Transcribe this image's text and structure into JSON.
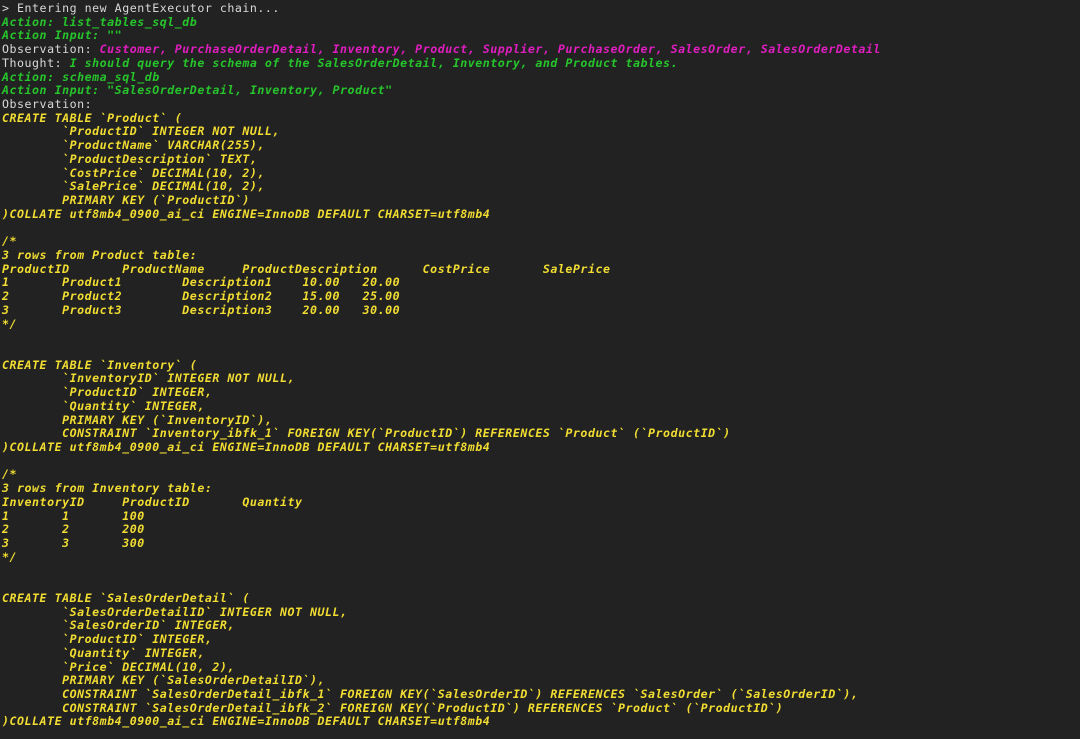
{
  "terminal": {
    "title": "AgentExecutor chain output",
    "colors": {
      "background": "#222222",
      "plain": "#d8d8d8",
      "green": "#27c52c",
      "magenta": "#e01ec0",
      "yellow": "#f2dd32"
    },
    "lines": [
      {
        "id": "l0",
        "role": "plain",
        "text": "> Entering new AgentExecutor chain..."
      },
      {
        "id": "l1",
        "role": "green",
        "text": "Action: list_tables_sql_db"
      },
      {
        "id": "l2",
        "role": "green",
        "text": "Action Input: \"\""
      },
      {
        "id": "l3",
        "role": "mixed",
        "label": "Observation: ",
        "label_role": "plain",
        "value": "Customer, PurchaseOrderDetail, Inventory, Product, Supplier, PurchaseOrder, SalesOrder, SalesOrderDetail",
        "value_role": "magenta"
      },
      {
        "id": "l4",
        "role": "mixed",
        "label": "Thought: ",
        "label_role": "plain",
        "value": "I should query the schema of the SalesOrderDetail, Inventory, and Product tables.",
        "value_role": "green"
      },
      {
        "id": "l5",
        "role": "green",
        "text": "Action: schema_sql_db"
      },
      {
        "id": "l6",
        "role": "green",
        "text": "Action Input: \"SalesOrderDetail, Inventory, Product\""
      },
      {
        "id": "l7",
        "role": "plain",
        "text": "Observation:"
      },
      {
        "id": "l8",
        "role": "yellow",
        "text": "CREATE TABLE `Product` ("
      },
      {
        "id": "l9",
        "role": "yellow",
        "text": "        `ProductID` INTEGER NOT NULL,"
      },
      {
        "id": "l10",
        "role": "yellow",
        "text": "        `ProductName` VARCHAR(255),"
      },
      {
        "id": "l11",
        "role": "yellow",
        "text": "        `ProductDescription` TEXT,"
      },
      {
        "id": "l12",
        "role": "yellow",
        "text": "        `CostPrice` DECIMAL(10, 2),"
      },
      {
        "id": "l13",
        "role": "yellow",
        "text": "        `SalePrice` DECIMAL(10, 2),"
      },
      {
        "id": "l14",
        "role": "yellow",
        "text": "        PRIMARY KEY (`ProductID`)"
      },
      {
        "id": "l15",
        "role": "yellow",
        "text": ")COLLATE utf8mb4_0900_ai_ci ENGINE=InnoDB DEFAULT CHARSET=utf8mb4"
      },
      {
        "id": "l16",
        "role": "blank",
        "text": ""
      },
      {
        "id": "l17",
        "role": "yellow",
        "text": "/*"
      },
      {
        "id": "l18",
        "role": "yellow",
        "text": "3 rows from Product table:"
      },
      {
        "id": "l19",
        "role": "yellow",
        "text": "ProductID\tProductName\tProductDescription\tCostPrice\tSalePrice"
      },
      {
        "id": "l20",
        "role": "yellow",
        "text": "1\tProduct1\tDescription1\t10.00\t20.00"
      },
      {
        "id": "l21",
        "role": "yellow",
        "text": "2\tProduct2\tDescription2\t15.00\t25.00"
      },
      {
        "id": "l22",
        "role": "yellow",
        "text": "3\tProduct3\tDescription3\t20.00\t30.00"
      },
      {
        "id": "l23",
        "role": "yellow",
        "text": "*/"
      },
      {
        "id": "l24",
        "role": "blank",
        "text": ""
      },
      {
        "id": "l25",
        "role": "blank",
        "text": ""
      },
      {
        "id": "l26",
        "role": "yellow",
        "text": "CREATE TABLE `Inventory` ("
      },
      {
        "id": "l27",
        "role": "yellow",
        "text": "        `InventoryID` INTEGER NOT NULL,"
      },
      {
        "id": "l28",
        "role": "yellow",
        "text": "        `ProductID` INTEGER,"
      },
      {
        "id": "l29",
        "role": "yellow",
        "text": "        `Quantity` INTEGER,"
      },
      {
        "id": "l30",
        "role": "yellow",
        "text": "        PRIMARY KEY (`InventoryID`),"
      },
      {
        "id": "l31",
        "role": "yellow",
        "text": "        CONSTRAINT `Inventory_ibfk_1` FOREIGN KEY(`ProductID`) REFERENCES `Product` (`ProductID`)"
      },
      {
        "id": "l32",
        "role": "yellow",
        "text": ")COLLATE utf8mb4_0900_ai_ci ENGINE=InnoDB DEFAULT CHARSET=utf8mb4"
      },
      {
        "id": "l33",
        "role": "blank",
        "text": ""
      },
      {
        "id": "l34",
        "role": "yellow",
        "text": "/*"
      },
      {
        "id": "l35",
        "role": "yellow",
        "text": "3 rows from Inventory table:"
      },
      {
        "id": "l36",
        "role": "yellow",
        "text": "InventoryID\tProductID\tQuantity"
      },
      {
        "id": "l37",
        "role": "yellow",
        "text": "1\t1\t100"
      },
      {
        "id": "l38",
        "role": "yellow",
        "text": "2\t2\t200"
      },
      {
        "id": "l39",
        "role": "yellow",
        "text": "3\t3\t300"
      },
      {
        "id": "l40",
        "role": "yellow",
        "text": "*/"
      },
      {
        "id": "l41",
        "role": "blank",
        "text": ""
      },
      {
        "id": "l42",
        "role": "blank",
        "text": ""
      },
      {
        "id": "l43",
        "role": "yellow",
        "text": "CREATE TABLE `SalesOrderDetail` ("
      },
      {
        "id": "l44",
        "role": "yellow",
        "text": "        `SalesOrderDetailID` INTEGER NOT NULL,"
      },
      {
        "id": "l45",
        "role": "yellow",
        "text": "        `SalesOrderID` INTEGER,"
      },
      {
        "id": "l46",
        "role": "yellow",
        "text": "        `ProductID` INTEGER,"
      },
      {
        "id": "l47",
        "role": "yellow",
        "text": "        `Quantity` INTEGER,"
      },
      {
        "id": "l48",
        "role": "yellow",
        "text": "        `Price` DECIMAL(10, 2),"
      },
      {
        "id": "l49",
        "role": "yellow",
        "text": "        PRIMARY KEY (`SalesOrderDetailID`),"
      },
      {
        "id": "l50",
        "role": "yellow",
        "text": "        CONSTRAINT `SalesOrderDetail_ibfk_1` FOREIGN KEY(`SalesOrderID`) REFERENCES `SalesOrder` (`SalesOrderID`),"
      },
      {
        "id": "l51",
        "role": "yellow",
        "text": "        CONSTRAINT `SalesOrderDetail_ibfk_2` FOREIGN KEY(`ProductID`) REFERENCES `Product` (`ProductID`)"
      },
      {
        "id": "l52",
        "role": "yellow",
        "text": ")COLLATE utf8mb4_0900_ai_ci ENGINE=InnoDB DEFAULT CHARSET=utf8mb4"
      }
    ]
  }
}
